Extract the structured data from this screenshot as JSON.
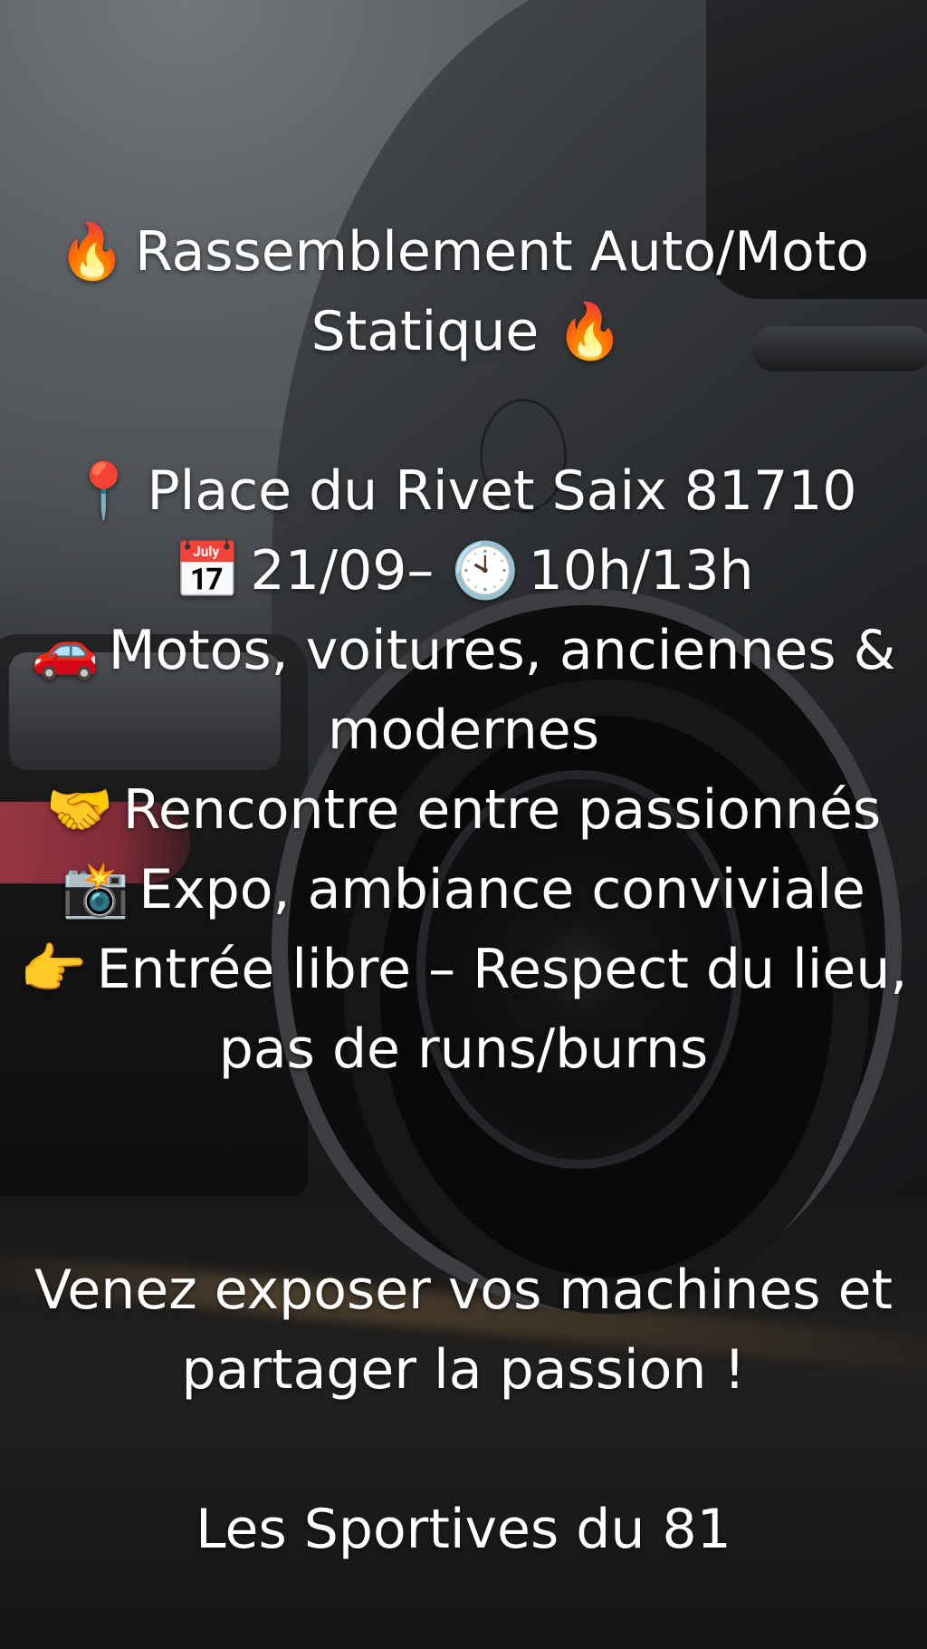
{
  "colors": {
    "text": "#ffffff",
    "taillight": "#d24a5a"
  },
  "title": {
    "prefix_icon": "fire-icon",
    "prefix_glyph": "🔥",
    "line1": "Rassemblement Auto/Moto",
    "line2": "Statique",
    "suffix_icon": "fire-icon",
    "suffix_glyph": "🔥"
  },
  "details": [
    {
      "icon": "pin-icon",
      "glyph": "📍",
      "text": "Place du Rivet Saix 81710"
    },
    {
      "icon": "calendar-icon",
      "glyph": "📅",
      "text": "21/09–",
      "icon2": "clock-icon",
      "glyph2": "🕙",
      "text2": "10h/13h"
    },
    {
      "icon": "car-icon",
      "glyph": "🚗",
      "text": "Motos, voitures, anciennes & modernes"
    },
    {
      "icon": "handshake-icon",
      "glyph": "🤝",
      "text": "Rencontre entre passionnés"
    },
    {
      "icon": "camera-flash-icon",
      "glyph": "📸",
      "text": "Expo, ambiance conviviale"
    },
    {
      "icon": "pointing-hand-icon",
      "glyph": "👉",
      "text": "Entrée libre – Respect du lieu, pas de runs/burns"
    }
  ],
  "call_to_action": {
    "line1": "Venez exposer vos machines et",
    "line2": "partager la passion !"
  },
  "signature": "Les Sportives du 81"
}
